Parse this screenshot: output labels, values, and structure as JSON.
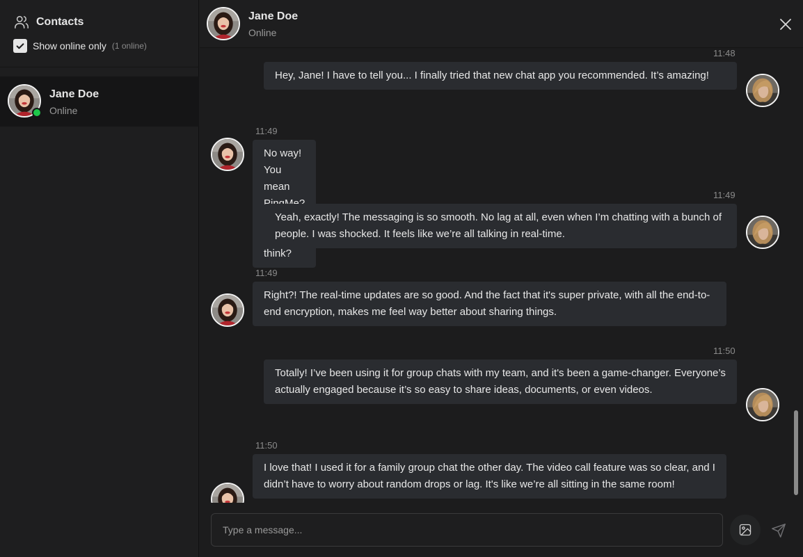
{
  "sidebar": {
    "title": "Contacts",
    "filter_label": "Show online only",
    "online_count": "(1 online)",
    "contact": {
      "name": "Jane Doe",
      "status": "Online"
    }
  },
  "header": {
    "name": "Jane Doe",
    "status": "Online"
  },
  "messages": [
    {
      "sender": "me",
      "time": "11:48",
      "text": "Hey, Jane! I have to tell you... I finally tried that new chat app you recommended. It’s amazing!"
    },
    {
      "sender": "jane",
      "time": "11:49",
      "text": "No way! You mean PingMe? What do you think?"
    },
    {
      "sender": "me",
      "time": "11:49",
      "text": "Yeah, exactly! The messaging is so smooth. No lag at all, even when I’m chatting with a bunch of people. I was shocked. It feels like we’re all talking in real-time."
    },
    {
      "sender": "jane",
      "time": "11:49",
      "text": "Right?! The real-time updates are so good. And the fact that it's super private, with all the end-to-end encryption, makes me feel way better about sharing things."
    },
    {
      "sender": "me",
      "time": "11:50",
      "text": "Totally! I’ve been using it for group chats with my team, and it's been a game-changer. Everyone’s actually engaged because it’s so easy to share ideas, documents, or even videos."
    },
    {
      "sender": "jane",
      "time": "11:50",
      "text": "I love that! I used it for a family group chat the other day. The video call feature was so clear, and I didn’t have to worry about random drops or lag. It's like we’re all sitting in the same room!"
    }
  ],
  "composer": {
    "placeholder": "Type a message..."
  },
  "colors": {
    "online": "#1ec74a",
    "bubble": "#2a2c30",
    "background": "#1c1c1d"
  },
  "icons": [
    "users-icon",
    "checkmark-icon",
    "close-icon",
    "image-icon",
    "send-icon"
  ]
}
